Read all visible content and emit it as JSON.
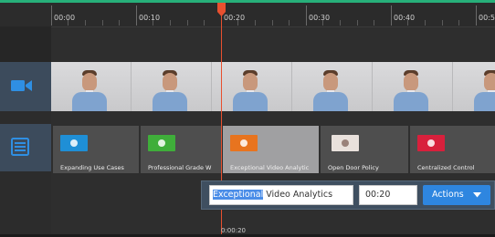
{
  "ruler": {
    "labels": [
      "00:00",
      "00:10",
      "00:20",
      "00:30",
      "00:40",
      "00:5"
    ]
  },
  "tracks": {
    "video": {
      "icon": "video-camera-icon"
    },
    "slides": {
      "icon": "slides-list-icon"
    }
  },
  "slides": [
    {
      "label": "Expanding Use Cases",
      "color": "#1f8fd6"
    },
    {
      "label": "Professional Grade W",
      "color": "#3fae3a"
    },
    {
      "label": "Exceptional Video Analytic",
      "color": "#e8741f"
    },
    {
      "label": "Open Door Policy",
      "color": "#e9e1dc"
    },
    {
      "label": "Centralized Control",
      "color": "#d8203c"
    }
  ],
  "editor": {
    "title_selected": "Exceptional",
    "title_rest": " Video Analytics",
    "time": "00:20",
    "actions_label": "Actions"
  },
  "playhead": {
    "time": "0:00:20"
  },
  "colors": {
    "playhead": "#e8502f",
    "accent": "#2e86e0",
    "track_header": "#3c4b5c",
    "frame_top": "#27b07a"
  }
}
